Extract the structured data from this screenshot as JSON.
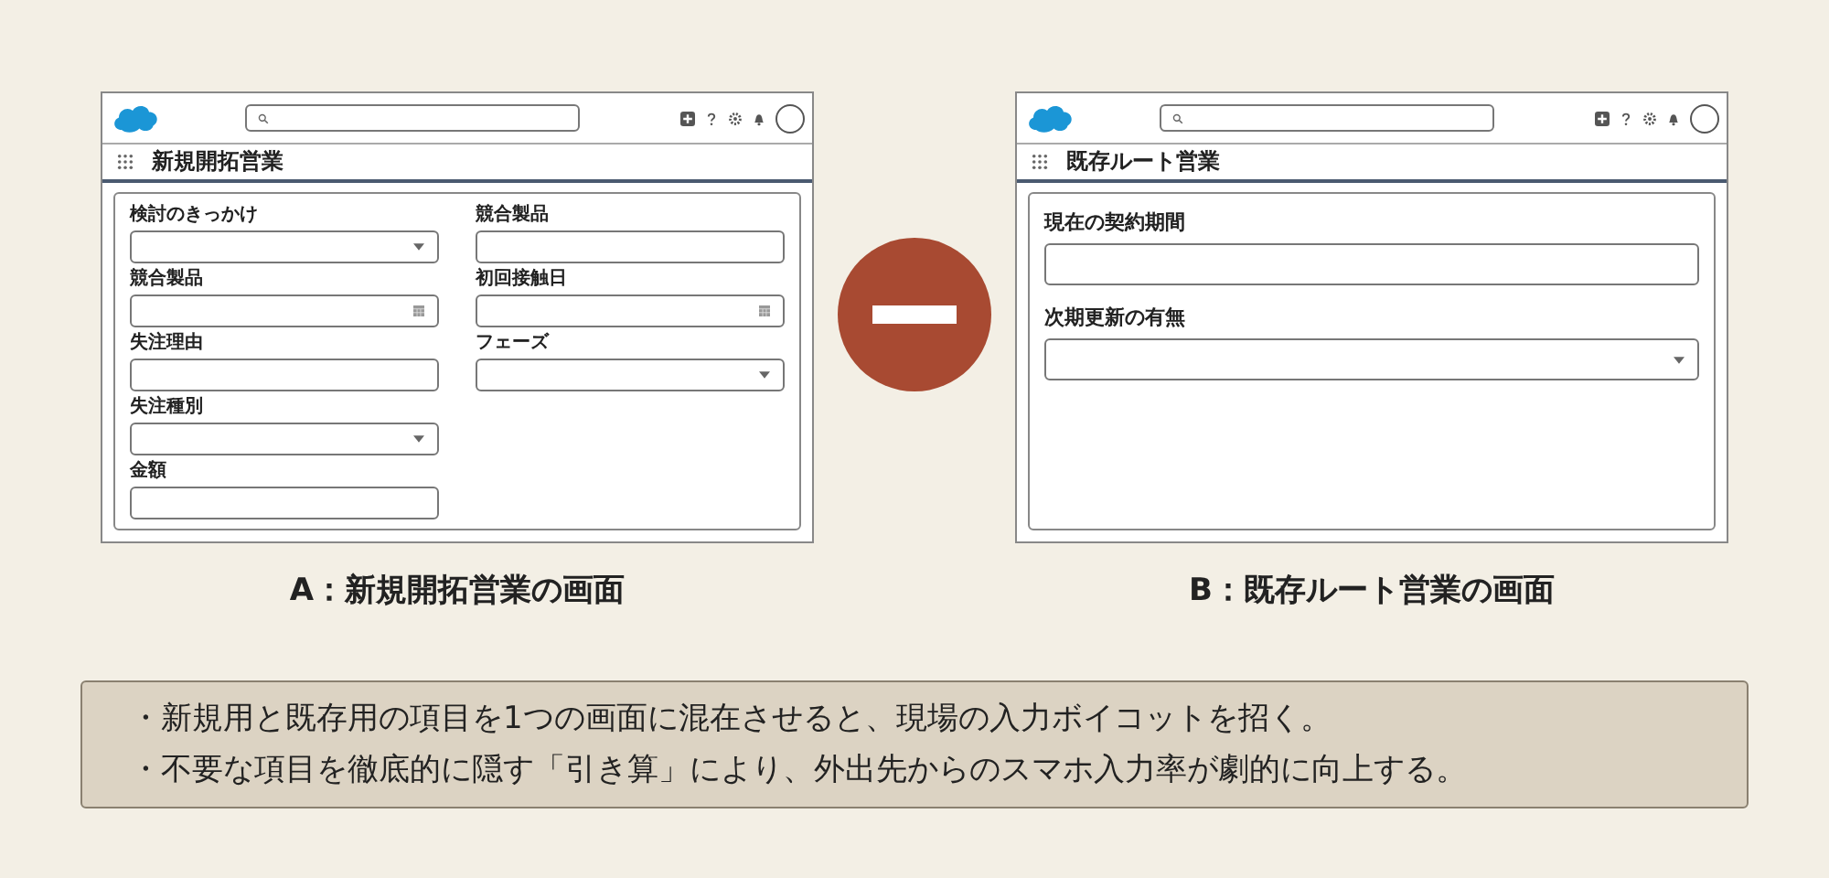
{
  "screens": [
    {
      "title": "新規開拓営業",
      "caption": "A：新規開拓営業の画面",
      "columns": [
        [
          {
            "label": "検討のきっかけ",
            "kind": "select"
          },
          {
            "label": "競合製品",
            "kind": "date"
          },
          {
            "label": "失注理由",
            "kind": "text"
          },
          {
            "label": "失注種別",
            "kind": "select"
          },
          {
            "label": "金額",
            "kind": "text"
          }
        ],
        [
          {
            "label": "競合製品",
            "kind": "text"
          },
          {
            "label": "初回接触日",
            "kind": "date"
          },
          {
            "label": "フェーズ",
            "kind": "select"
          }
        ]
      ]
    },
    {
      "title": "既存ルート営業",
      "caption": "B：既存ルート営業の画面",
      "columns": [
        [
          {
            "label": "現在の契約期間",
            "kind": "text"
          },
          {
            "label": "次期更新の有無",
            "kind": "select"
          }
        ]
      ]
    }
  ],
  "operator": {
    "kind": "minus"
  },
  "notes": [
    "・新規用と既存用の項目を1つの画面に混在させると、現場の入力ボイコットを招く。",
    "・不要な項目を徹底的に隠す「引き算」により、外出先からのスマホ入力率が劇的に向上する。"
  ]
}
